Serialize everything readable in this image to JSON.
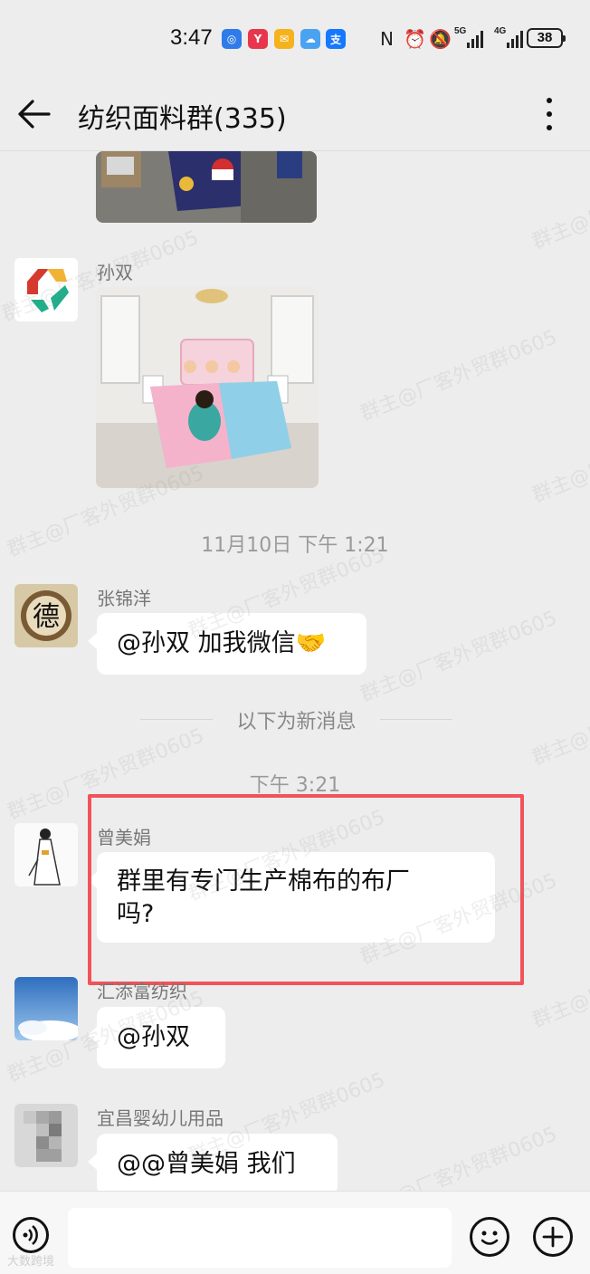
{
  "status_bar": {
    "time": "3:47",
    "net_1": "5G",
    "net_2": "4G",
    "battery": "38"
  },
  "header": {
    "title": "纺织面料群(335)"
  },
  "messages": {
    "m1_sender": "孙双",
    "time_1": "11月10日  下午 1:21",
    "m2_sender": "张锦洋",
    "m2_text": "@孙双 加我微信🤝",
    "new_divider": "以下为新消息",
    "time_2": "下午 3:21",
    "m3_sender": "曾美娟",
    "m3_text_line1": "群里有专门生产棉布的布厂",
    "m3_text_line2": "吗?",
    "m4_sender": "汇添富纺织",
    "m4_text": "@孙双",
    "m5_sender": "宜昌婴幼儿用品",
    "m5_text": "@@曾美娟  我们"
  },
  "watermark": "群主@厂客外贸群0605",
  "footer_watermark": "大数跨境",
  "colors": {
    "background": "#ededed",
    "bubble": "#ffffff",
    "highlight": "#f2535b"
  },
  "icons": [
    "back-arrow-icon",
    "more-dots-icon",
    "voice-icon",
    "emoji-icon",
    "plus-icon"
  ]
}
